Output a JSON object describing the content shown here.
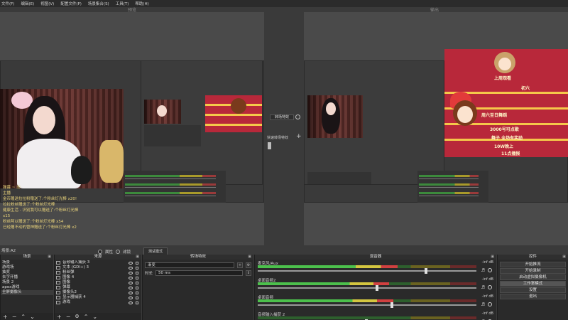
{
  "menu": [
    "文件(F)",
    "编辑(E)",
    "视图(V)",
    "配置文件(P)",
    "场景集合(S)",
    "工具(T)",
    "帮助(H)"
  ],
  "panes": {
    "preview_label": "预览",
    "program_label": "输出"
  },
  "poster": {
    "line1": "上周观看",
    "line2": "初六",
    "line3": "周六至日舞蹈",
    "line4": "3000号可点歌",
    "line5": "舞子 全场有奖励",
    "line6": "10W晚上",
    "line7": "11点播报"
  },
  "overlay_chat": [
    {
      "name": "",
      "text": "弹幕 ~ 动"
    },
    {
      "name": "",
      "text": "主播"
    },
    {
      "name": "",
      "text": "金币赠送拉拉粉赠送了:个粉丝灯光棒 x20!"
    },
    {
      "name": "",
      "text": "拉拉粉丝赠送了:个粉丝灯光棒"
    },
    {
      "name": "",
      "text": "健康生活 - 识别我可以赠送了:个粉丝灯光棒"
    },
    {
      "name": "",
      "text": "x15"
    },
    {
      "name": "",
      "text": "粉丝阿以赠送了:个粉丝灯光棒 x54"
    },
    {
      "name": "",
      "text": "已经赠不动的管神赠送了:个粉丝灯光棒 x2"
    }
  ],
  "transition_mid": {
    "button": "转场特效",
    "quick_label": "快速转场特效"
  },
  "scene_label": "场景:A2",
  "radio": {
    "a_label": "属性",
    "b_label": "滤镜",
    "button": "测试模式"
  },
  "scenes_dock": {
    "title": "场景",
    "items": [
      "场景",
      "游戏场",
      "抽奖",
      "去字开播",
      "场景 2",
      "apex游戏",
      "全屏摄像头"
    ],
    "selected": 6
  },
  "sources_dock": {
    "title": "来源",
    "items": [
      "音频输入捕获 3",
      "文本 (GDI+) 3",
      "粉丝弹",
      "图像 4",
      "图像",
      "弹幕",
      "摄像头2",
      "显示器捕获 4",
      "游戏"
    ]
  },
  "transition_dock": {
    "title": "转场特效",
    "type": "渐变",
    "duration_label": "时长",
    "duration": "50 ms"
  },
  "mixer_dock": {
    "title": "混音器",
    "channels": [
      {
        "name": "麦克风/Aux",
        "db": "-inf dB",
        "level": 0.64,
        "volume": 0.78
      },
      {
        "name": "桌面音频2",
        "db": "-inf dB",
        "level": 0.6,
        "volume": 0.55
      },
      {
        "name": "桌面音频",
        "db": "-inf dB",
        "level": 0.62,
        "volume": 0.62
      },
      {
        "name": "音频输入捕获 2",
        "db": "-inf dB",
        "level": 0.0,
        "volume": 0.5
      }
    ]
  },
  "controls_dock": {
    "title": "控件",
    "buttons": [
      "开始推流",
      "开始录制",
      "启动虚拟摄像机",
      "工作室模式",
      "设置",
      "退出"
    ]
  }
}
